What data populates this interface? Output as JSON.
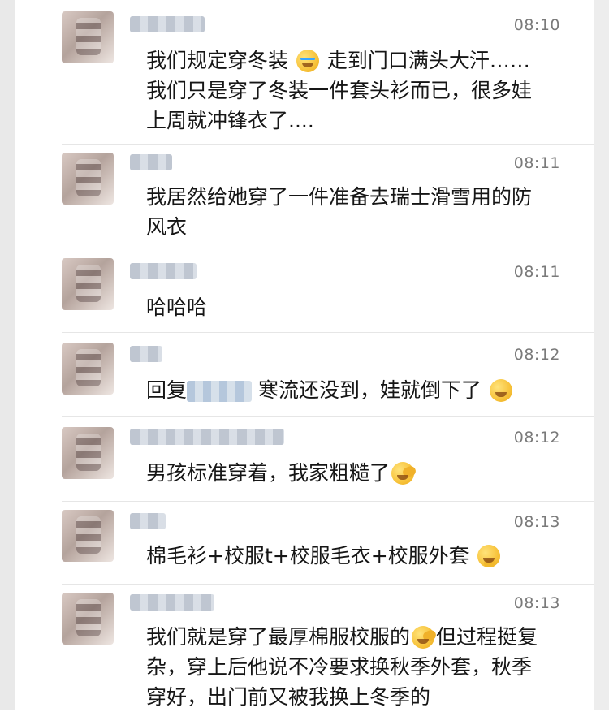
{
  "messages": [
    {
      "time": "08:10",
      "text": "我们规定穿冬装",
      "emoji": "crying-face-emoji",
      "text_after_emoji": "走到门口满头大汗……\n我们只是穿了冬装一件套头衫而已，很多娃\n上周就冲锋衣了...."
    },
    {
      "time": "08:11",
      "text": "我居然给她穿了一件准备去瑞士滑雪用的防\n风衣"
    },
    {
      "time": "08:11",
      "text": "哈哈哈"
    },
    {
      "time": "08:12",
      "reply_prefix": "回复",
      "text": "寒流还没到，娃就倒下了",
      "emoji": "tears-of-joy-emoji"
    },
    {
      "time": "08:12",
      "text": "男孩标准穿着，我家粗糙了",
      "emoji": "facepalm-emoji"
    },
    {
      "time": "08:13",
      "text": "棉毛衫+校服t+校服毛衣+校服外套",
      "emoji": "thinking-emoji"
    },
    {
      "time": "08:13",
      "text": "我们就是穿了最厚棉服校服的",
      "emoji": "facepalm-emoji",
      "text_after_emoji": "但过程挺复\n杂，穿上后他说不冷要求换秋季外套，秋季\n穿好，出门前又被我换上冬季的"
    }
  ]
}
